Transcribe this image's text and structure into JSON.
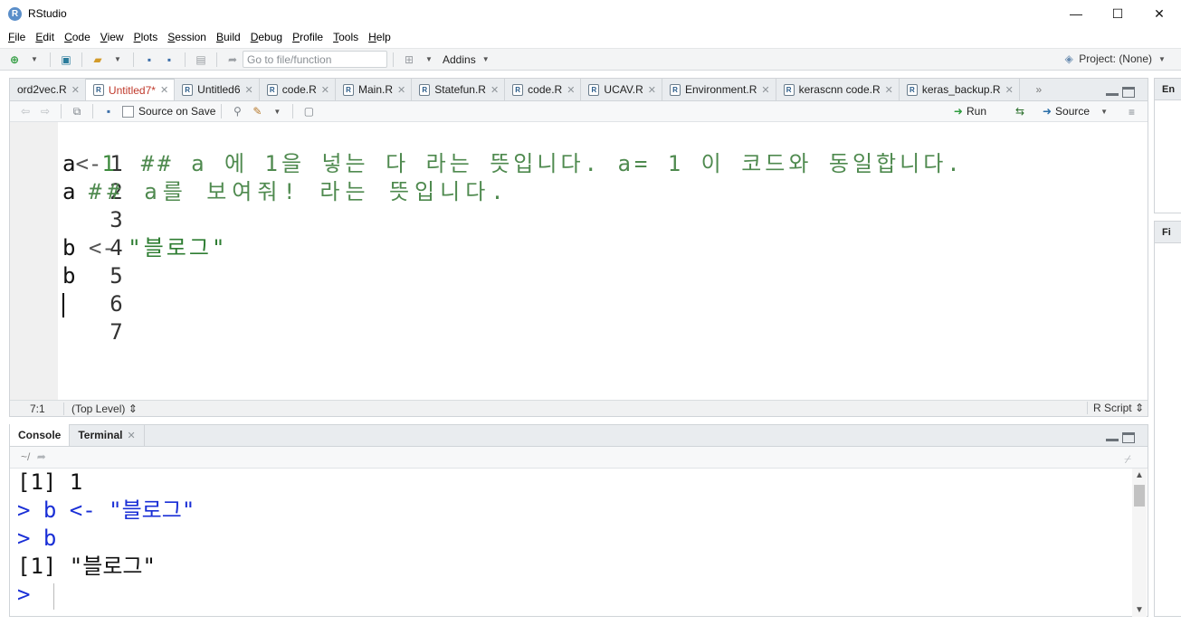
{
  "window": {
    "title": "RStudio",
    "controls": {
      "minimize": "—",
      "maximize": "☐",
      "close": "✕"
    }
  },
  "menu": [
    {
      "pre": "",
      "key": "F",
      "rest": "ile"
    },
    {
      "pre": "",
      "key": "E",
      "rest": "dit"
    },
    {
      "pre": "",
      "key": "C",
      "rest": "ode"
    },
    {
      "pre": "",
      "key": "V",
      "rest": "iew"
    },
    {
      "pre": "",
      "key": "P",
      "rest": "lots"
    },
    {
      "pre": "",
      "key": "S",
      "rest": "ession"
    },
    {
      "pre": "",
      "key": "B",
      "rest": "uild"
    },
    {
      "pre": "",
      "key": "D",
      "rest": "ebug"
    },
    {
      "pre": "",
      "key": "P",
      "rest": "rofile"
    },
    {
      "pre": "",
      "key": "T",
      "rest": "ools"
    },
    {
      "pre": "",
      "key": "H",
      "rest": "elp"
    }
  ],
  "toolbar": {
    "goto_placeholder": "Go to file/function",
    "addins_label": "Addins",
    "project_label": "Project: (None)"
  },
  "editor": {
    "tabs": [
      {
        "label": "ord2vec.R",
        "active": false
      },
      {
        "label": "Untitled7*",
        "active": true
      },
      {
        "label": "Untitled6",
        "active": false
      },
      {
        "label": "code.R",
        "active": false
      },
      {
        "label": "Main.R",
        "active": false
      },
      {
        "label": "Statefun.R",
        "active": false
      },
      {
        "label": "code.R",
        "active": false
      },
      {
        "label": "UCAV.R",
        "active": false
      },
      {
        "label": "Environment.R",
        "active": false
      },
      {
        "label": "kerascnn code.R",
        "active": false
      },
      {
        "label": "keras_backup.R",
        "active": false
      }
    ],
    "source_on_save_label": "Source on Save",
    "run_label": "Run",
    "source_label": "Source",
    "lines": [
      "1",
      "2",
      "3",
      "4",
      "5",
      "6",
      "7"
    ],
    "code": {
      "l2_id": "a",
      "l2_op": "<-",
      "l2_num": "1",
      "l2_comment": "## a 에 1을 넣는 다 라는 뜻입니다. a= 1 이 코드와 동일합니다.",
      "l3_id": "a",
      "l3_comment": "## a를 보여줘! 라는 뜻입니다.",
      "l5_id": "b",
      "l5_op": "<-",
      "l5_str": "\"블로그\"",
      "l6_id": "b"
    },
    "status": {
      "position": "7:1",
      "scope": "(Top Level) ⇕",
      "filetype": "R Script ⇕"
    }
  },
  "console": {
    "tabs": [
      {
        "label": "Console",
        "active": true
      },
      {
        "label": "Terminal",
        "active": false
      }
    ],
    "path": "~/",
    "lines": [
      {
        "kind": "out",
        "text": "[1] 1"
      },
      {
        "kind": "cmd",
        "text": "> b <- \"블로그\""
      },
      {
        "kind": "cmd",
        "text": "> b"
      },
      {
        "kind": "out",
        "text": "[1] \"블로그\""
      },
      {
        "kind": "cmd",
        "text": ">"
      }
    ]
  },
  "right_panes": {
    "top_tab": "En",
    "bottom_tab": "Fi"
  },
  "colors": {
    "prompt": "#1a2fd6",
    "comment": "#4f8a4f",
    "string": "#2e7d32",
    "active_tab_text": "#c0392b"
  }
}
